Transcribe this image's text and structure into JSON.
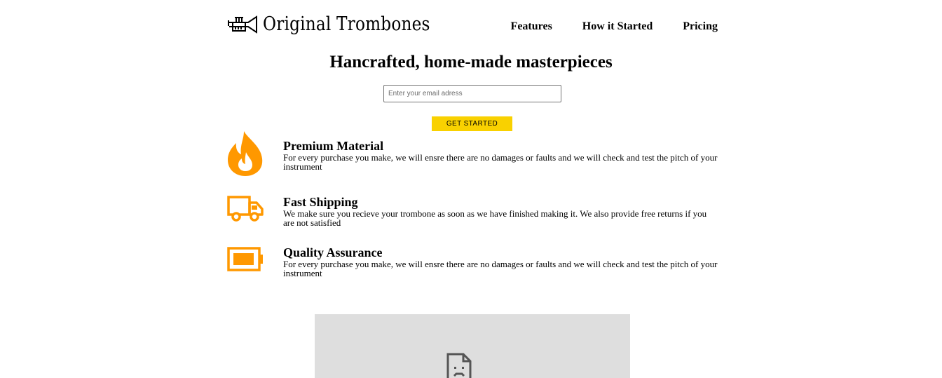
{
  "header": {
    "brand": "Original Trombones",
    "nav": [
      {
        "label": "Features"
      },
      {
        "label": "How it Started"
      },
      {
        "label": "Pricing"
      }
    ]
  },
  "hero": {
    "title": "Hancrafted, home-made masterpieces",
    "email_placeholder": "Enter your email adress",
    "cta_label": "GET STARTED"
  },
  "features": [
    {
      "icon": "fire-icon",
      "title": "Premium Material",
      "description": "For every purchase you make, we will ensre there are no damages or faults and we will check and test the pitch of your instrument"
    },
    {
      "icon": "truck-icon",
      "title": "Fast Shipping",
      "description": "We make sure you recieve your trombone as soon as we have finished making it. We also provide free returns if you are not satisfied"
    },
    {
      "icon": "battery-icon",
      "title": "Quality Assurance",
      "description": "For every purchase you make, we will ensre there are no damages or faults and we will check and test the pitch of your instrument"
    }
  ],
  "colors": {
    "accent": "#ff9800",
    "cta": "#f9d100",
    "video_bg": "#dedede"
  }
}
